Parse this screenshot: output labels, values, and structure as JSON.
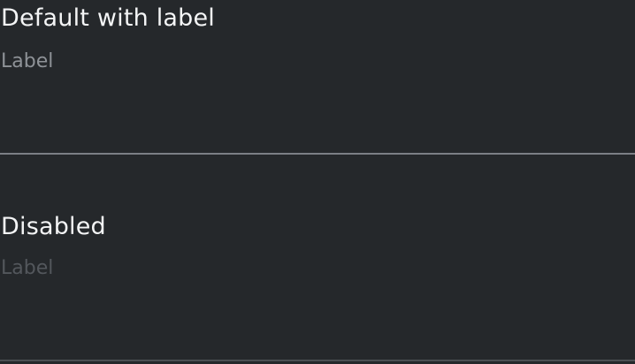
{
  "sections": [
    {
      "title": "Default with label",
      "field": {
        "label": "Label",
        "disabled": false
      }
    },
    {
      "title": "Disabled",
      "field": {
        "label": "Label",
        "disabled": true
      }
    }
  ],
  "colors": {
    "background": "#25282b",
    "title_text": "#f4f5f6",
    "label_text": "#8e9297",
    "label_text_disabled": "#53575c",
    "underline": "#7c8085",
    "underline_disabled": "#4b4f53"
  }
}
